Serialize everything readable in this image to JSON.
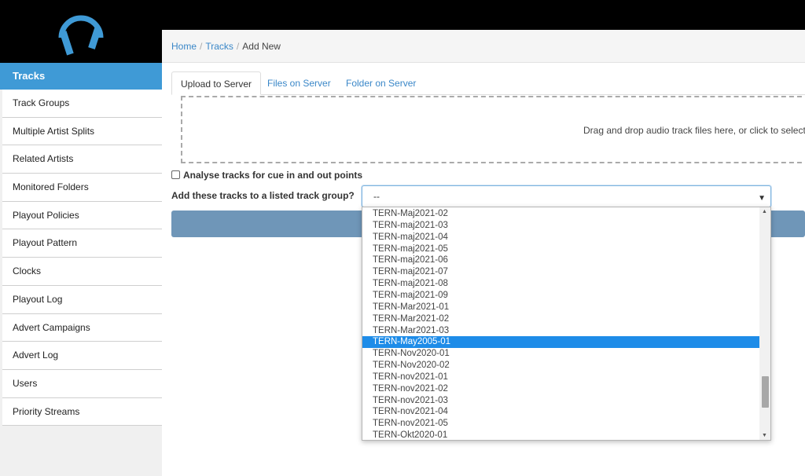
{
  "sidebar": {
    "active": "Tracks",
    "items": [
      {
        "label": "Track Groups",
        "name": "sidebar-item-track-groups"
      },
      {
        "label": "Multiple Artist Splits",
        "name": "sidebar-item-multiple-artist-splits"
      },
      {
        "label": "Related Artists",
        "name": "sidebar-item-related-artists"
      },
      {
        "label": "Monitored Folders",
        "name": "sidebar-item-monitored-folders"
      },
      {
        "label": "Playout Policies",
        "name": "sidebar-item-playout-policies"
      },
      {
        "label": "Playout Pattern",
        "name": "sidebar-item-playout-pattern"
      },
      {
        "label": "Clocks",
        "name": "sidebar-item-clocks"
      },
      {
        "label": "Playout Log",
        "name": "sidebar-item-playout-log"
      },
      {
        "label": "Advert Campaigns",
        "name": "sidebar-item-advert-campaigns"
      },
      {
        "label": "Advert Log",
        "name": "sidebar-item-advert-log"
      },
      {
        "label": "Users",
        "name": "sidebar-item-users"
      },
      {
        "label": "Priority Streams",
        "name": "sidebar-item-priority-streams"
      }
    ]
  },
  "breadcrumb": {
    "home": "Home",
    "tracks": "Tracks",
    "current": "Add New"
  },
  "tabs": {
    "upload": "Upload to Server",
    "files": "Files on Server",
    "folder": "Folder on Server"
  },
  "dropzone": {
    "text": "Drag and drop audio track files here, or click to select"
  },
  "analyse": {
    "label": "Analyse tracks for cue in and out points",
    "checked": false
  },
  "track_group": {
    "label": "Add these tracks to a listed track group?",
    "selected": "--",
    "options": [
      "TERN-Maj2021-02",
      "TERN-maj2021-03",
      "TERN-maj2021-04",
      "TERN-maj2021-05",
      "TERN-maj2021-06",
      "TERN-maj2021-07",
      "TERN-maj2021-08",
      "TERN-maj2021-09",
      "TERN-Mar2021-01",
      "TERN-Mar2021-02",
      "TERN-Mar2021-03",
      "TERN-May2005-01",
      "TERN-Nov2020-01",
      "TERN-Nov2020-02",
      "TERN-nov2021-01",
      "TERN-nov2021-02",
      "TERN-nov2021-03",
      "TERN-nov2021-04",
      "TERN-nov2021-05",
      "TERN-Okt2020-01"
    ],
    "highlighted": "TERN-May2005-01"
  },
  "colors": {
    "sidebar_active": "#3f9ad6",
    "link": "#3a87c8",
    "highlight": "#1e8ce8",
    "upload_bar": "#6f96b8",
    "logo": "#3f9ad6"
  },
  "icons": {
    "logo": "headphones-icon",
    "select_chevron": "chevron-down-icon",
    "scroll_up": "scroll-up-arrow-icon",
    "scroll_down": "scroll-down-arrow-icon"
  }
}
